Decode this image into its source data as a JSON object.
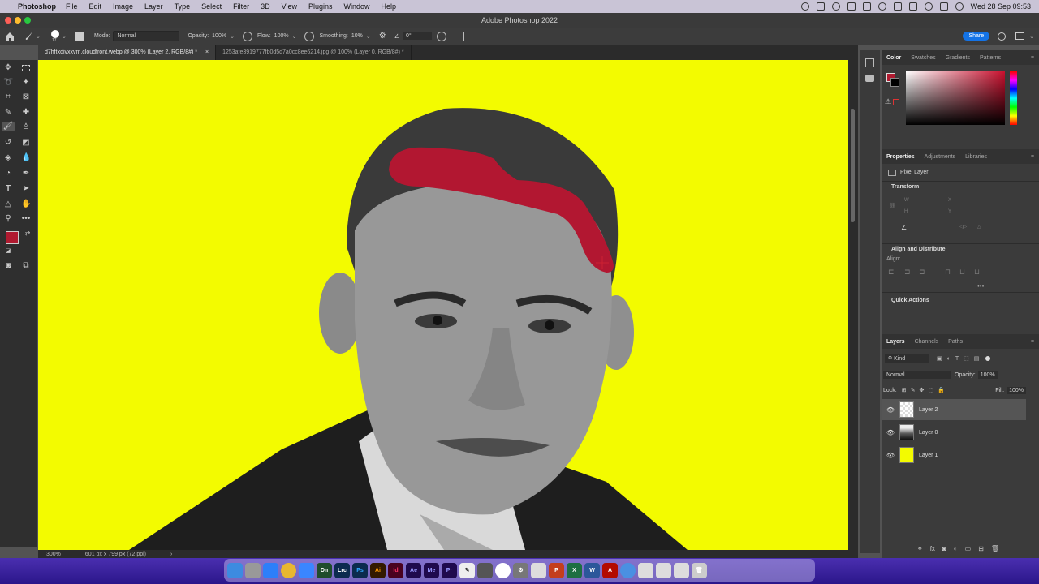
{
  "menubar": {
    "app_name": "Photoshop",
    "items": [
      "File",
      "Edit",
      "Image",
      "Layer",
      "Type",
      "Select",
      "Filter",
      "3D",
      "View",
      "Plugins",
      "Window",
      "Help"
    ],
    "clock": "Wed 28 Sep  09:53"
  },
  "window": {
    "title": "Adobe Photoshop 2022"
  },
  "options": {
    "brush_size": "17",
    "mode_label": "Mode:",
    "mode_value": "Normal",
    "opacity_label": "Opacity:",
    "opacity_value": "100%",
    "flow_label": "Flow:",
    "flow_value": "100%",
    "smoothing_label": "Smoothing:",
    "smoothing_value": "10%",
    "angle_value": "0°",
    "share_label": "Share"
  },
  "tabs": [
    {
      "label": "d7hftxdivxxvm.cloudfront.webp @ 300% (Layer 2, RGB/8#) *",
      "active": true
    },
    {
      "label": "1253afe3919777fb0d5d7a0cc8ee6214.jpg @ 100% (Layer 0, RGB/8#) *",
      "active": false
    }
  ],
  "status": {
    "zoom": "300%",
    "doc_size": "601 px x 799 px (72 ppi)"
  },
  "colors": {
    "foreground": "#b01a30",
    "background": "#000000",
    "canvas_bg": "#f3fb00",
    "stroke": "#b21731"
  },
  "color_panel": {
    "tabs": [
      "Color",
      "Swatches",
      "Gradients",
      "Patterns"
    ],
    "active": "Color"
  },
  "properties_panel": {
    "tabs": [
      "Properties",
      "Adjustments",
      "Libraries"
    ],
    "active": "Properties",
    "kind": "Pixel Layer",
    "sections": {
      "transform": "Transform",
      "align": "Align and Distribute",
      "align_label": "Align:",
      "quick": "Quick Actions"
    }
  },
  "layers_panel": {
    "tabs": [
      "Layers",
      "Channels",
      "Paths"
    ],
    "active": "Layers",
    "kind": "Kind",
    "blend": "Normal",
    "opacity_label": "Opacity:",
    "opacity": "100%",
    "lock_label": "Lock:",
    "fill_label": "Fill:",
    "fill": "100%",
    "layers": [
      {
        "name": "Layer 2",
        "selected": true,
        "thumb": "transparent"
      },
      {
        "name": "Layer 0",
        "selected": false,
        "thumb": "photo"
      },
      {
        "name": "Layer 1",
        "selected": false,
        "thumb": "#f3fb00"
      }
    ]
  },
  "dock": {
    "apps": [
      "Finder",
      "Launchpad",
      "Safari",
      "Chrome",
      "Mail",
      "Dn",
      "Lrc",
      "Ps",
      "Ai",
      "Id",
      "Ae",
      "Me",
      "Pr",
      "Notes",
      "Preview",
      "Photos",
      "Settings",
      "Files",
      "PowerPoint",
      "Excel",
      "Word",
      "Acrobat",
      "Downloads",
      "Folder",
      "Folder",
      "Folder",
      "Trash"
    ]
  }
}
